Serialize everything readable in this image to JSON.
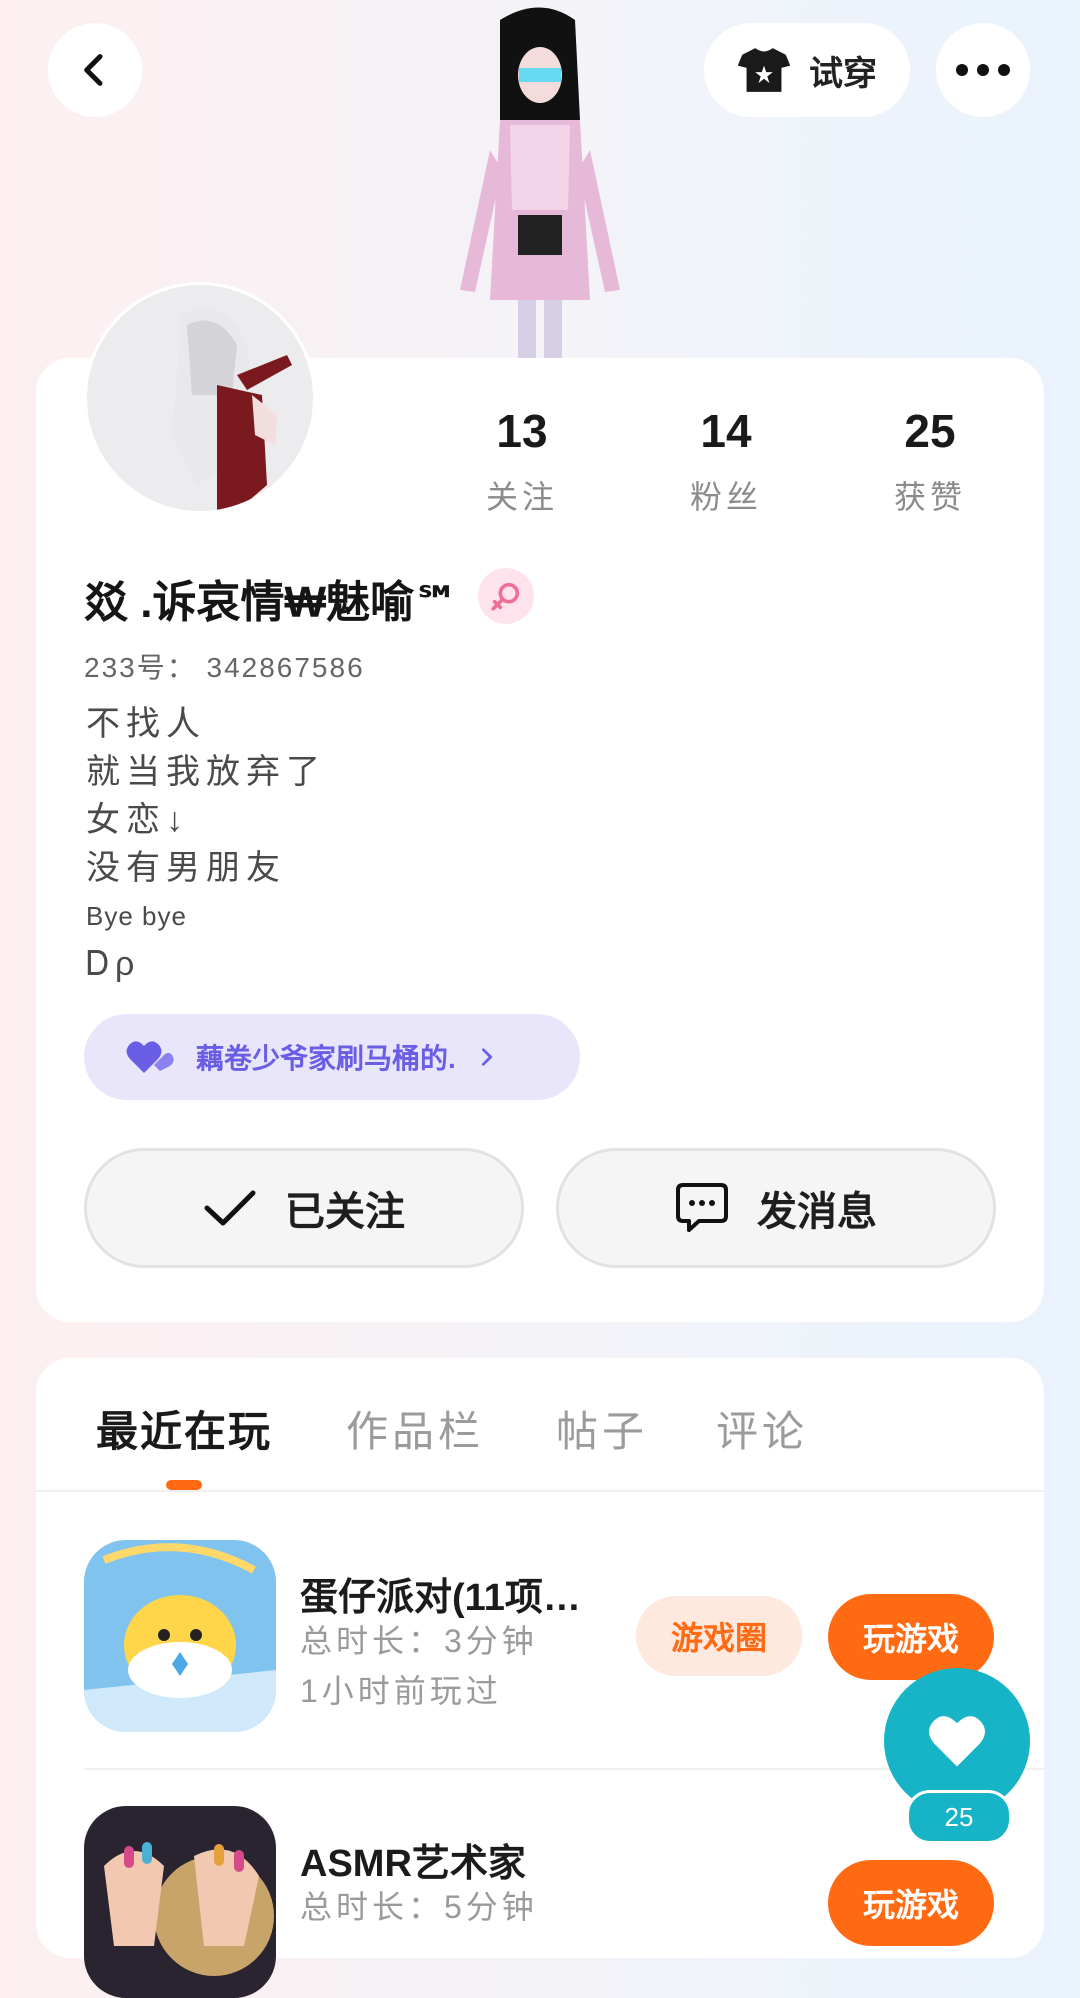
{
  "header": {
    "back_icon": "chevron-left-icon",
    "tryon_label": "试穿",
    "tryon_icon": "tshirt-icon",
    "more_icon": "more-horizontal-icon"
  },
  "profile": {
    "stats": [
      {
        "value": "13",
        "label": "关注"
      },
      {
        "value": "14",
        "label": "粉丝"
      },
      {
        "value": "25",
        "label": "获赞"
      }
    ],
    "name": "㸚 .诉哀情₩魅喻℠",
    "gender_icon": "female-icon",
    "uid": "233号： 342867586",
    "bio": [
      "不找人",
      "就当我放弃了",
      "女恋↓",
      "没有男朋友",
      "Bye bye",
      "Ꭰρ"
    ],
    "guild_label": "藕卷少爷家刷马桶的.",
    "follow_label": "已关注",
    "message_label": "发消息"
  },
  "tabs": [
    "最近在玩",
    "作品栏",
    "帖子",
    "评论"
  ],
  "games": [
    {
      "title": "蛋仔派对(11项…",
      "duration": "总时长：3分钟",
      "last_played": "1小时前玩过",
      "circle_label": "游戏圈",
      "play_label": "玩游戏"
    },
    {
      "title": "ASMR艺术家",
      "duration": "总时长：5分钟",
      "play_label": "玩游戏"
    }
  ],
  "like": {
    "count": "25",
    "icon": "heart-icon"
  },
  "colors": {
    "accent": "#ff6a13",
    "guild_bg": "#e9e6fc",
    "guild_text": "#6a5ee6",
    "like_bg": "#16b4c6"
  }
}
